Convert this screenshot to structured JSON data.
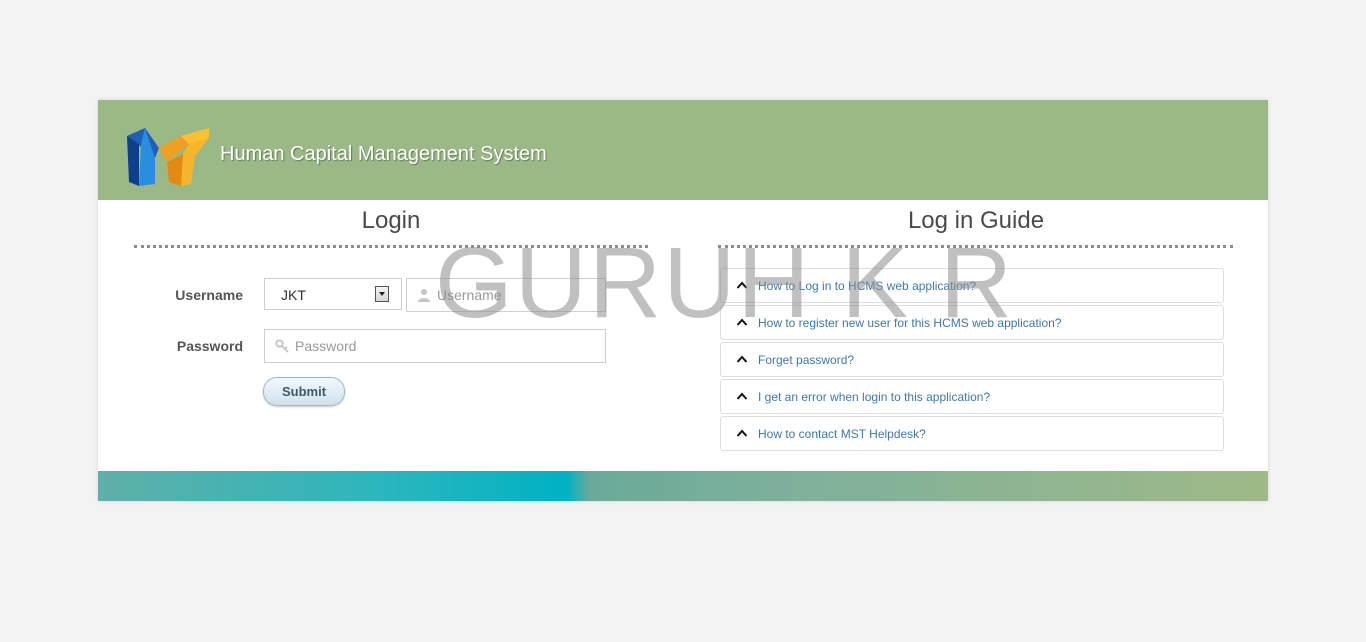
{
  "header": {
    "app_title": "Human Capital Management System",
    "logo_name": "hcms-logo",
    "background_color": "#9bb887"
  },
  "login": {
    "title": "Login",
    "username_label": "Username",
    "password_label": "Password",
    "location_select_value": "JKT",
    "username_placeholder": "Username",
    "password_placeholder": "Password",
    "submit_label": "Submit"
  },
  "guide": {
    "title": "Log in Guide",
    "items": [
      {
        "label": "How to Log in to HCMS web application?"
      },
      {
        "label": "How to register new user for this HCMS web application?"
      },
      {
        "label": "Forget password?"
      },
      {
        "label": "I get an error when login to this application?"
      },
      {
        "label": "How to contact MST Helpdesk?"
      }
    ],
    "link_color": "#3c78ab"
  },
  "watermark": {
    "text": "GURUH K R"
  }
}
